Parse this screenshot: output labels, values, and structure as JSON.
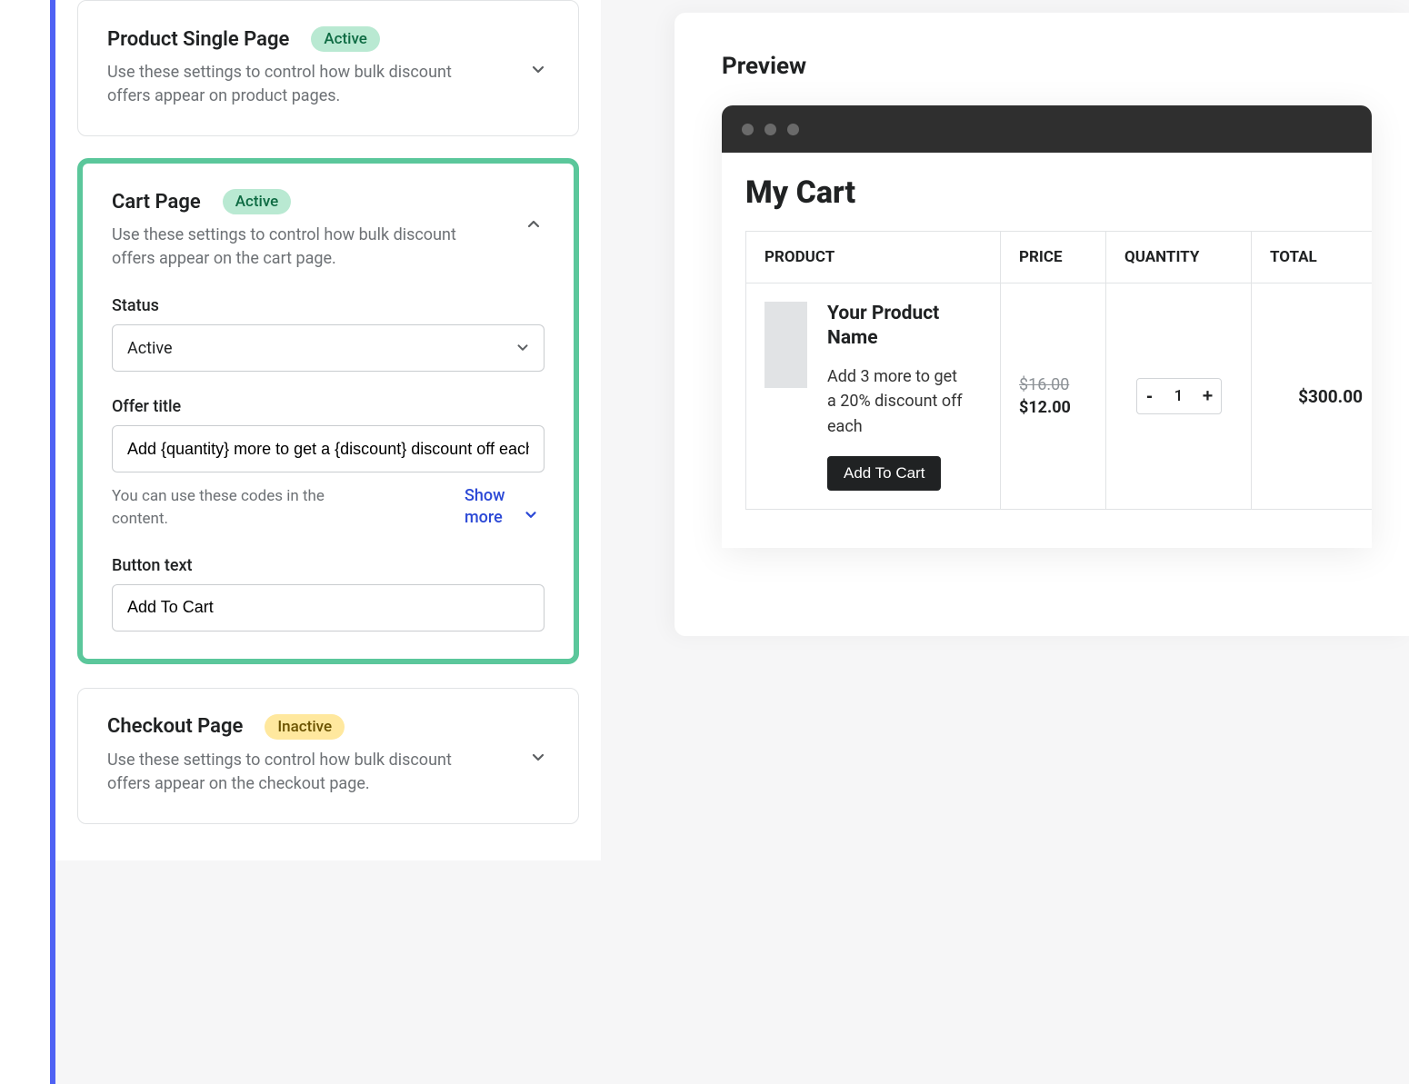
{
  "settings": {
    "productSingle": {
      "title": "Product Single Page",
      "badge": "Active",
      "desc": "Use these settings to control how bulk discount offers appear on product pages."
    },
    "cartPage": {
      "title": "Cart Page",
      "badge": "Active",
      "desc": "Use these settings to control how bulk discount offers appear on the cart page.",
      "statusLabel": "Status",
      "statusValue": "Active",
      "offerTitleLabel": "Offer title",
      "offerTitleValue": "Add {quantity} more to get a {discount} discount off each",
      "helpText": "You can use these codes in the content.",
      "showMore": "Show more",
      "buttonTextLabel": "Button text",
      "buttonTextValue": "Add To Cart"
    },
    "checkoutPage": {
      "title": "Checkout Page",
      "badge": "Inactive",
      "desc": "Use these settings to control how bulk discount offers appear on the checkout page."
    }
  },
  "preview": {
    "heading": "Preview",
    "cartTitle": "My Cart",
    "columns": {
      "product": "PRODUCT",
      "price": "PRICE",
      "quantity": "QUANTITY",
      "total": "TOTAL"
    },
    "item": {
      "name": "Your Product Name",
      "offer": "Add 3 more to get a 20% discount off each",
      "button": "Add To Cart",
      "priceOld": "$16.00",
      "priceNew": "$12.00",
      "qty": "1",
      "total": "$300.00"
    }
  }
}
